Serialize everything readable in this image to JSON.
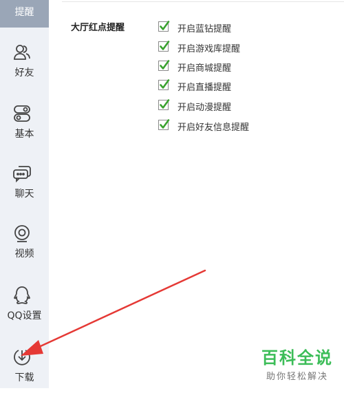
{
  "sidebar": {
    "active_item": "提醒",
    "items": [
      {
        "label": "好友",
        "icon": "friends-icon"
      },
      {
        "label": "基本",
        "icon": "toggle-icon"
      },
      {
        "label": "聊天",
        "icon": "chat-icon"
      },
      {
        "label": "视频",
        "icon": "camera-icon"
      },
      {
        "label": "QQ设置",
        "icon": "qq-penguin-icon"
      },
      {
        "label": "下载",
        "icon": "download-icon"
      }
    ]
  },
  "main": {
    "section_title": "大厅红点提醒",
    "options": [
      {
        "label": "开启蓝钻提醒",
        "checked": true
      },
      {
        "label": "开启游戏库提醒",
        "checked": true
      },
      {
        "label": "开启商城提醒",
        "checked": true
      },
      {
        "label": "开启直播提醒",
        "checked": true
      },
      {
        "label": "开启动漫提醒",
        "checked": true
      },
      {
        "label": "开启好友信息提醒",
        "checked": true
      }
    ]
  },
  "watermark": {
    "title": "百科全说",
    "subtitle": "助你轻松解决"
  },
  "colors": {
    "accent_green": "#3cbd58",
    "check_green": "#3aa12f",
    "annotation_red": "#e53935",
    "sidebar_bg": "#eef1f6",
    "active_bg": "#9aa6b7"
  }
}
